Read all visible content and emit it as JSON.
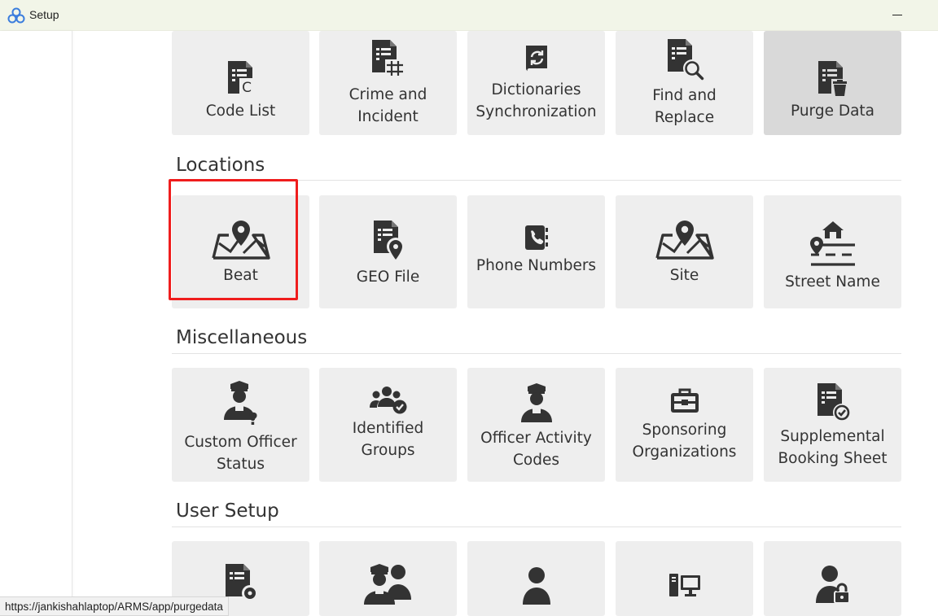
{
  "window": {
    "title": "Setup"
  },
  "sections": {
    "general": {
      "tiles": [
        {
          "label_lines": [
            "Code List"
          ],
          "icon": "code-list-icon"
        },
        {
          "label_lines": [
            "Crime and",
            "Incident"
          ],
          "icon": "crime-incident-icon"
        },
        {
          "label_lines": [
            "Dictionaries",
            "Synchronization"
          ],
          "icon": "dictionary-sync-icon"
        },
        {
          "label_lines": [
            "Find and",
            "Replace"
          ],
          "icon": "find-replace-icon"
        },
        {
          "label_lines": [
            "Purge Data"
          ],
          "icon": "purge-data-icon"
        }
      ]
    },
    "locations": {
      "title": "Locations",
      "tiles": [
        {
          "label_lines": [
            "Beat"
          ],
          "icon": "map-pin-icon"
        },
        {
          "label_lines": [
            "GEO File"
          ],
          "icon": "geo-file-icon"
        },
        {
          "label_lines": [
            "Phone Numbers"
          ],
          "icon": "phone-book-icon"
        },
        {
          "label_lines": [
            "Site"
          ],
          "icon": "map-pin-icon"
        },
        {
          "label_lines": [
            "Street Name"
          ],
          "icon": "street-house-icon"
        }
      ]
    },
    "misc": {
      "title": "Miscellaneous",
      "tiles": [
        {
          "label_lines": [
            "Custom Officer",
            "Status"
          ],
          "icon": "officer-question-icon"
        },
        {
          "label_lines": [
            "Identified",
            "Groups"
          ],
          "icon": "group-check-icon"
        },
        {
          "label_lines": [
            "Officer Activity",
            "Codes"
          ],
          "icon": "officer-icon"
        },
        {
          "label_lines": [
            "Sponsoring",
            "Organizations"
          ],
          "icon": "briefcase-icon"
        },
        {
          "label_lines": [
            "Supplemental",
            "Booking Sheet"
          ],
          "icon": "document-check-icon"
        }
      ]
    },
    "user_setup": {
      "title": "User Setup",
      "tiles": [
        {
          "label_lines": [],
          "icon": "document-gear-icon"
        },
        {
          "label_lines": [],
          "icon": "officer-group-icon"
        },
        {
          "label_lines": [],
          "icon": "user-icon"
        },
        {
          "label_lines": [],
          "icon": "computer-icon"
        },
        {
          "label_lines": [],
          "icon": "user-lock-icon"
        }
      ]
    }
  },
  "status_url": "https://jankishahlaptop/ARMS/app/purgedata",
  "colors": {
    "tile_bg": "#eeeeee",
    "tile_active_bg": "#d9d9d9",
    "highlight": "#ef1d1d",
    "icon": "#333333",
    "app_icon": "#3b7ddd"
  }
}
